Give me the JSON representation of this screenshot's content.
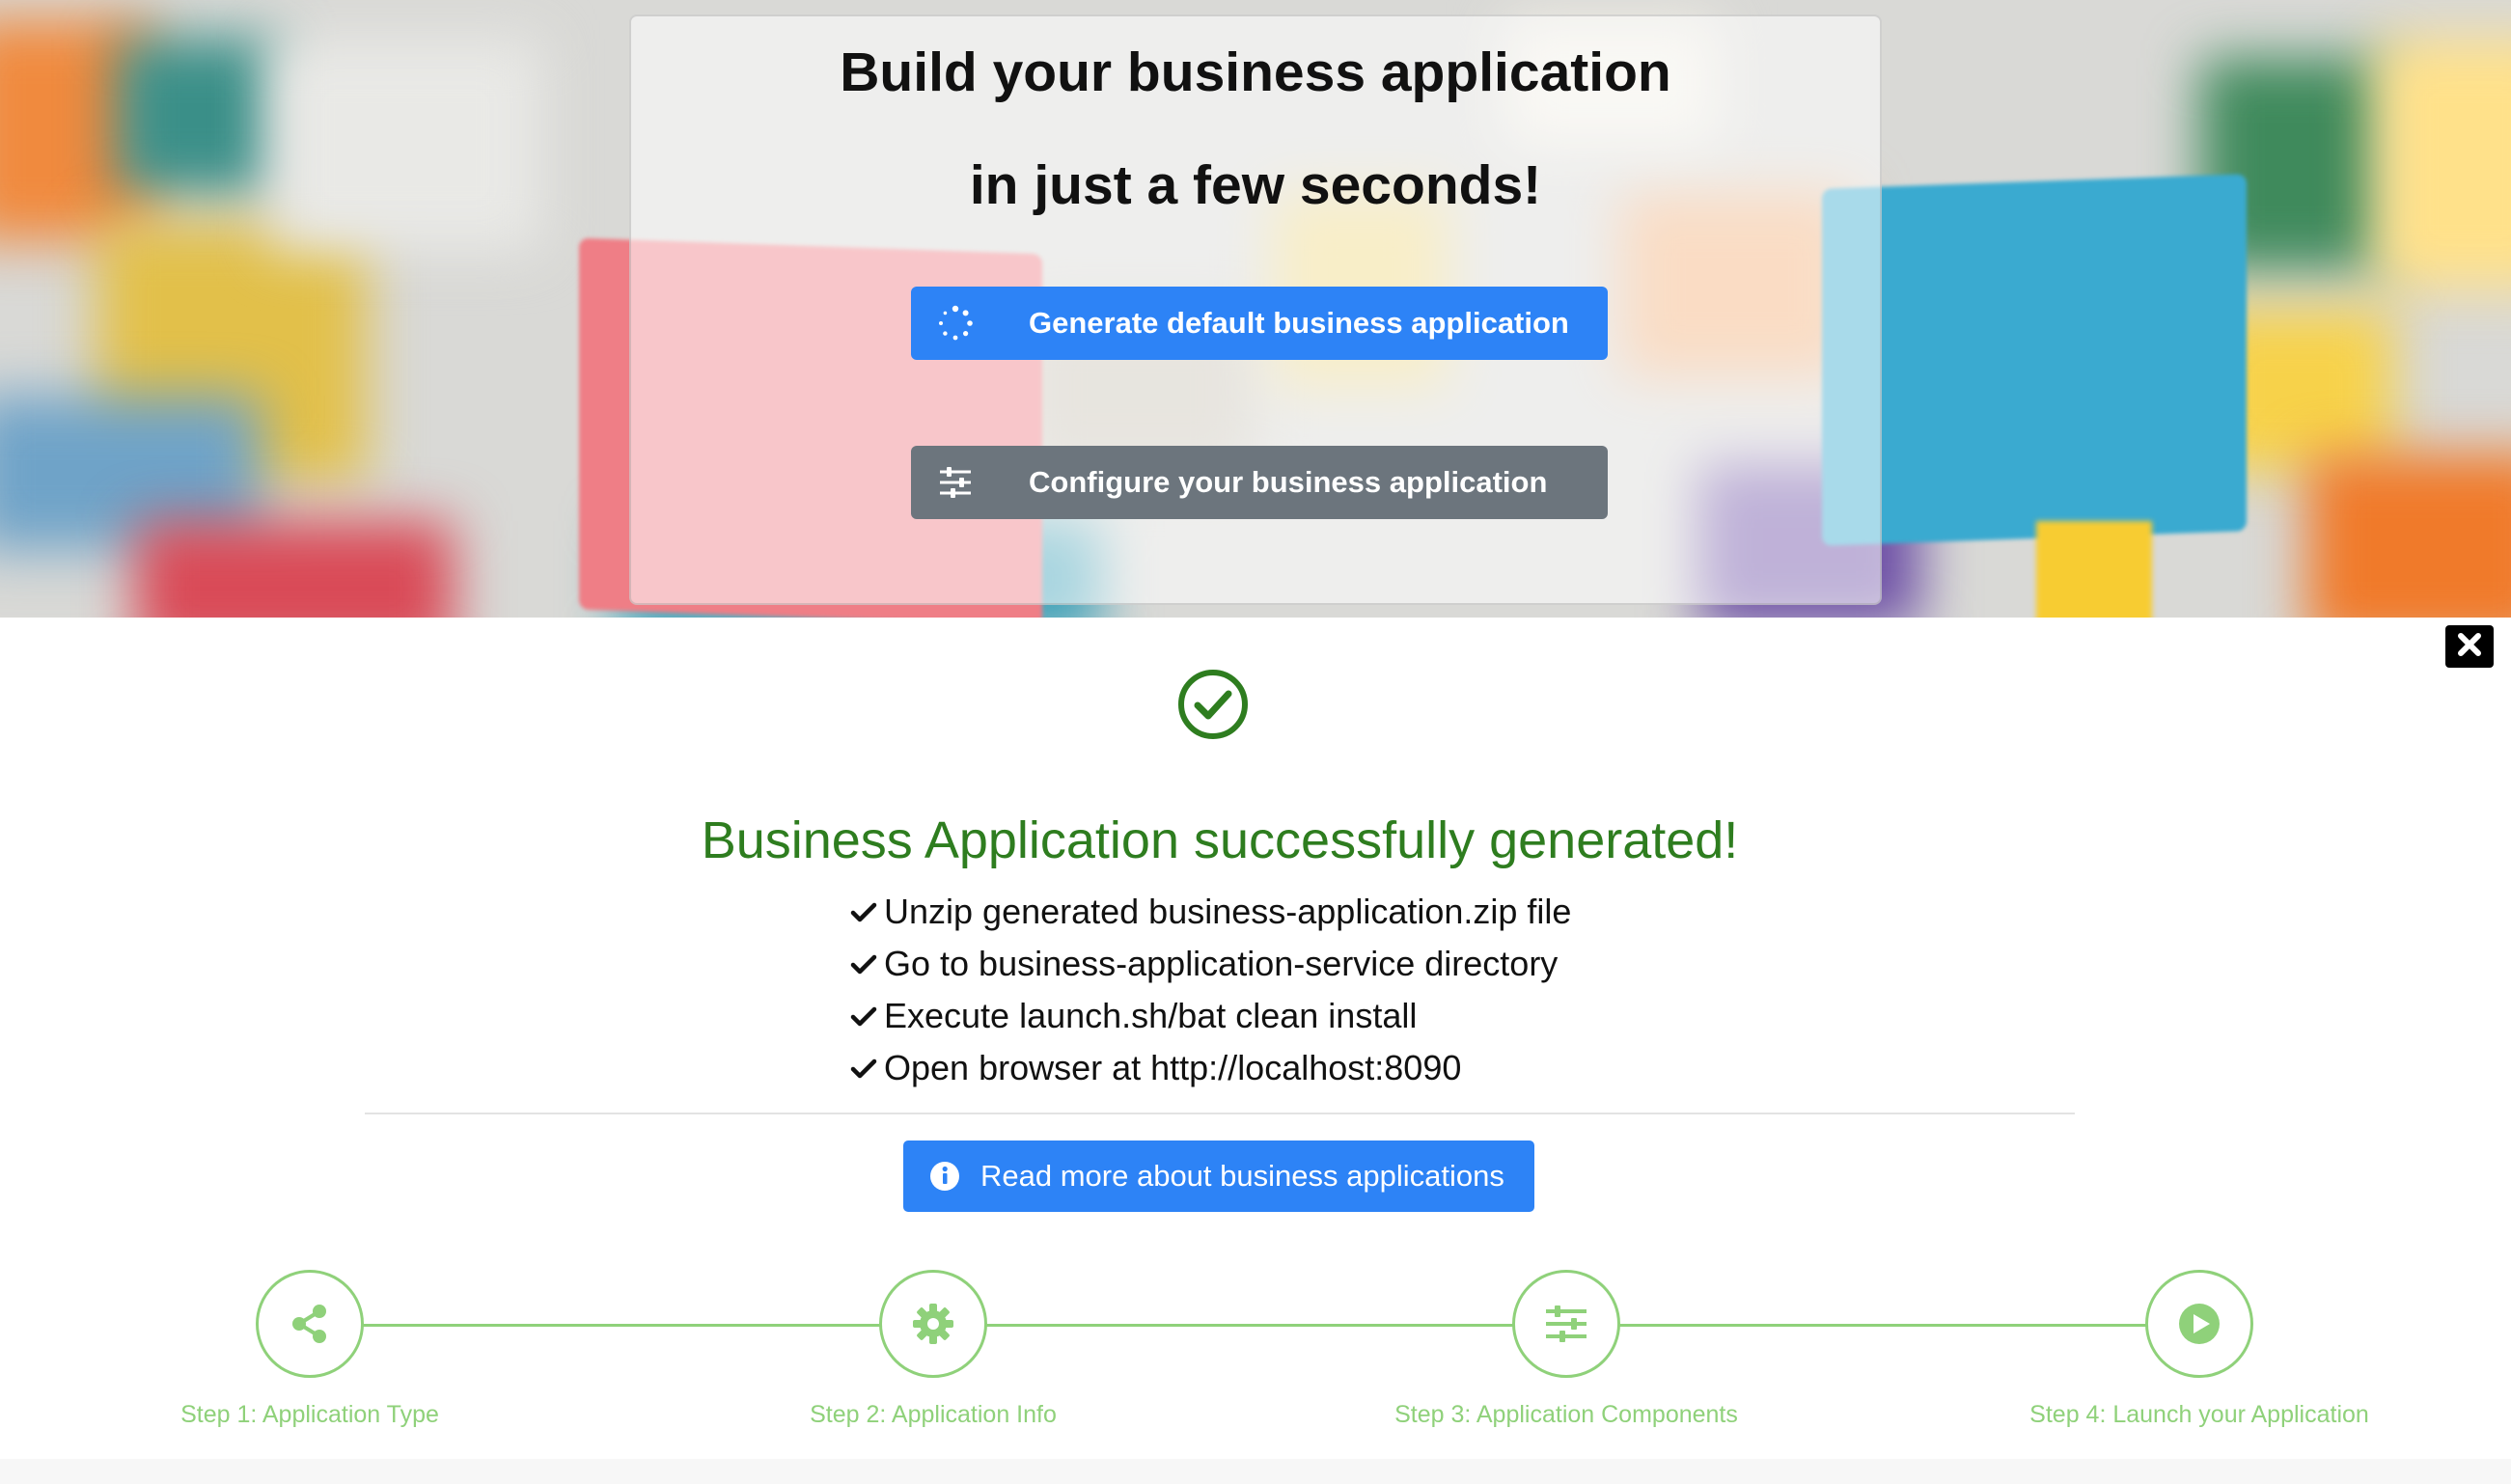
{
  "hero": {
    "title_line1": "Build your business application",
    "title_line2": "in just a few seconds!",
    "generate_button": {
      "label": "Generate default business application",
      "icon": "spinner-icon"
    },
    "configure_button": {
      "label": "Configure your business application",
      "icon": "sliders-icon"
    }
  },
  "close_button": {
    "icon": "close-icon"
  },
  "success": {
    "icon": "check-circle-icon",
    "title": "Business Application successfully generated!",
    "steps": [
      "Unzip generated business-application.zip file",
      "Go to business-application-service directory",
      "Execute launch.sh/bat clean install",
      "Open browser at http://localhost:8090"
    ],
    "read_more_label": "Read more about business applications"
  },
  "wizard": {
    "steps": [
      {
        "label": "Step 1: Application Type",
        "icon": "share-icon"
      },
      {
        "label": "Step 2: Application Info",
        "icon": "gear-icon"
      },
      {
        "label": "Step 3: Application Components",
        "icon": "sliders-icon"
      },
      {
        "label": "Step 4: Launch your Application",
        "icon": "play-icon"
      }
    ]
  },
  "colors": {
    "primary": "#2d83f6",
    "secondary": "#6c757d",
    "success_green": "#2e7d1f",
    "wizard_green": "#8fd17a"
  }
}
